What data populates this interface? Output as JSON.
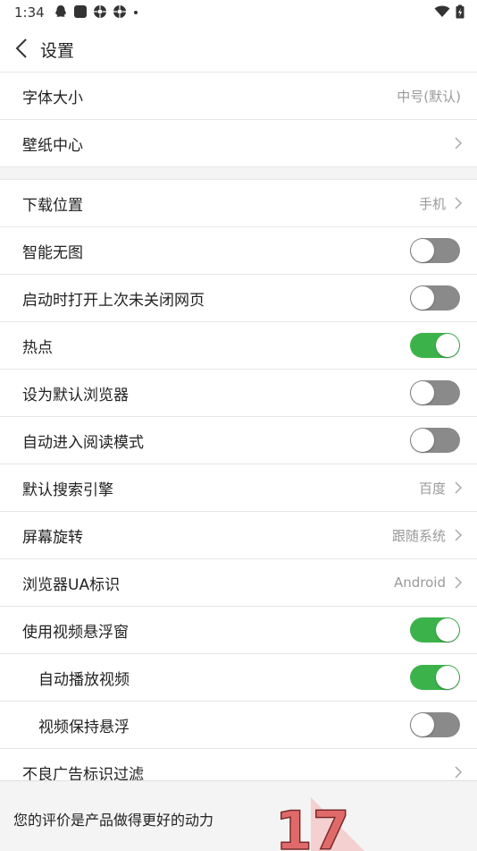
{
  "status": {
    "time": "1:34",
    "icons": [
      "qq-icon",
      "app-square-icon",
      "aperture-icon",
      "aperture-icon",
      "dot-icon"
    ],
    "right_icons": [
      "wifi-icon",
      "battery-charging-icon"
    ]
  },
  "header": {
    "title": "设置"
  },
  "settings": {
    "font_size": {
      "label": "字体大小",
      "value": "中号(默认)"
    },
    "wallpaper": {
      "label": "壁纸中心"
    },
    "download": {
      "label": "下载位置",
      "value": "手机"
    },
    "smart_noimg": {
      "label": "智能无图",
      "on": false
    },
    "restore": {
      "label": "启动时打开上次未关闭网页",
      "on": false
    },
    "hotspot": {
      "label": "热点",
      "on": true
    },
    "default_browser": {
      "label": "设为默认浏览器",
      "on": false
    },
    "reader_mode": {
      "label": "自动进入阅读模式",
      "on": false
    },
    "search_engine": {
      "label": "默认搜索引擎",
      "value": "百度"
    },
    "rotation": {
      "label": "屏幕旋转",
      "value": "跟随系统"
    },
    "ua": {
      "label": "浏览器UA标识",
      "value": "Android"
    },
    "video_float": {
      "label": "使用视频悬浮窗",
      "on": true
    },
    "autoplay": {
      "label": "自动播放视频",
      "on": true
    },
    "keep_float": {
      "label": "视频保持悬浮",
      "on": false
    },
    "ad_filter": {
      "label": "不良广告标识过滤"
    }
  },
  "footer": {
    "text": "您的评价是产品做得更好的动力",
    "badge": "17"
  },
  "colors": {
    "toggle_on": "#3cb34a",
    "toggle_off": "#8a8a8a",
    "divider": "#e6e6e6"
  }
}
